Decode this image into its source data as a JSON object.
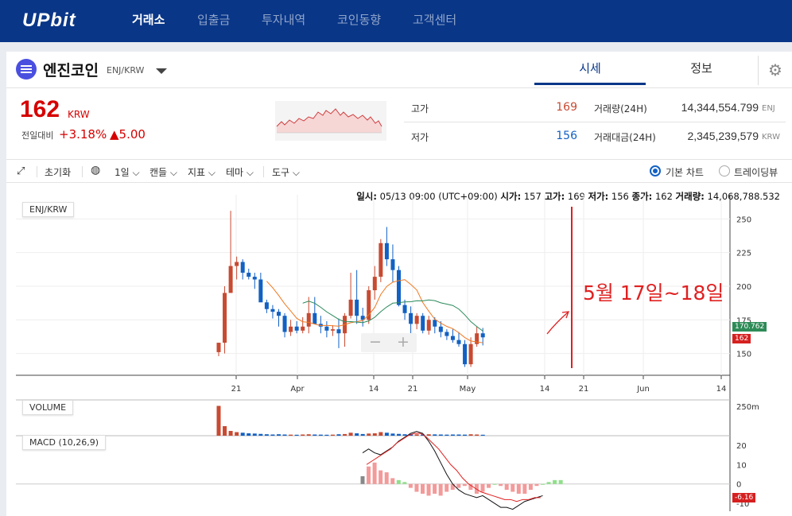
{
  "nav": {
    "logo": "UPbit",
    "items": [
      "거래소",
      "입출금",
      "투자내역",
      "코인동향",
      "고객센터"
    ]
  },
  "coin": {
    "name": "엔진코인",
    "pair": "ENJ/KRW",
    "icon": "enj-coin-icon"
  },
  "tabs": {
    "quote": "시세",
    "info": "정보"
  },
  "price": {
    "value": "162",
    "unit": "KRW",
    "change_label": "전일대비",
    "change_pct": "+3.18%",
    "change_abs": "▲5.00"
  },
  "stats": {
    "high_label": "고가",
    "high": "169",
    "low_label": "저가",
    "low": "156",
    "volume_label": "거래량(24H)",
    "volume": "14,344,554.799",
    "volume_unit": "ENJ",
    "amount_label": "거래대금(24H)",
    "amount": "2,345,239,579",
    "amount_unit": "KRW"
  },
  "toolbar": {
    "reset": "초기화",
    "period": "1일",
    "candle": "캔들",
    "indicator": "지표",
    "theme": "테마",
    "tools": "도구",
    "basic_chart": "기본 차트",
    "trading_view": "트레이딩뷰"
  },
  "infobar": {
    "date_label": "일시:",
    "date": "05/13 09:00 (UTC+09:00)",
    "open_label": "시가:",
    "open": "157",
    "high_label": "고가:",
    "high": "169",
    "low_label": "저가:",
    "low": "156",
    "close_label": "종가:",
    "close": "162",
    "volume_label": "거래량:",
    "volume": "14,068,788.532"
  },
  "chart_labels": {
    "main": "ENJ/KRW",
    "volume": "VOLUME",
    "macd": "MACD (10,26,9)"
  },
  "annotation": "5월 17일~18일",
  "price_tags": {
    "ma": "170.762",
    "last": "162"
  },
  "macd_tag": "-6.16",
  "colors": {
    "up": "#c84a31",
    "down": "#1261c4",
    "nav": "#093687",
    "accent": "#e02020"
  },
  "chart_data": {
    "type": "candlestick",
    "x_ticks": [
      "21",
      "Apr",
      "14",
      "21",
      "May",
      "14",
      "21",
      "Jun",
      "14"
    ],
    "y_ticks": [
      250,
      225,
      200,
      175,
      150
    ],
    "volume_ticks": [
      "250m"
    ],
    "macd_ticks": [
      20,
      10,
      0,
      -10
    ],
    "candles": [
      {
        "o": 151,
        "h": 158,
        "l": 148,
        "c": 158
      },
      {
        "o": 158,
        "h": 200,
        "l": 150,
        "c": 195
      },
      {
        "o": 195,
        "h": 256,
        "l": 195,
        "c": 215
      },
      {
        "o": 215,
        "h": 222,
        "l": 205,
        "c": 218
      },
      {
        "o": 218,
        "h": 220,
        "l": 205,
        "c": 210
      },
      {
        "o": 210,
        "h": 213,
        "l": 205,
        "c": 207
      },
      {
        "o": 207,
        "h": 210,
        "l": 198,
        "c": 205
      },
      {
        "o": 205,
        "h": 210,
        "l": 190,
        "c": 188
      },
      {
        "o": 188,
        "h": 190,
        "l": 180,
        "c": 183
      },
      {
        "o": 183,
        "h": 186,
        "l": 176,
        "c": 181
      },
      {
        "o": 181,
        "h": 183,
        "l": 170,
        "c": 178
      },
      {
        "o": 178,
        "h": 180,
        "l": 162,
        "c": 166
      },
      {
        "o": 166,
        "h": 175,
        "l": 163,
        "c": 170
      },
      {
        "o": 170,
        "h": 174,
        "l": 165,
        "c": 167
      },
      {
        "o": 167,
        "h": 177,
        "l": 165,
        "c": 170
      },
      {
        "o": 170,
        "h": 192,
        "l": 165,
        "c": 180
      },
      {
        "o": 180,
        "h": 192,
        "l": 172,
        "c": 172
      },
      {
        "o": 172,
        "h": 178,
        "l": 165,
        "c": 170
      },
      {
        "o": 170,
        "h": 174,
        "l": 162,
        "c": 167
      },
      {
        "o": 167,
        "h": 171,
        "l": 163,
        "c": 168
      },
      {
        "o": 168,
        "h": 176,
        "l": 154,
        "c": 165
      },
      {
        "o": 165,
        "h": 180,
        "l": 155,
        "c": 178
      },
      {
        "o": 178,
        "h": 210,
        "l": 176,
        "c": 190
      },
      {
        "o": 190,
        "h": 212,
        "l": 172,
        "c": 178
      },
      {
        "o": 178,
        "h": 184,
        "l": 170,
        "c": 175
      },
      {
        "o": 175,
        "h": 200,
        "l": 172,
        "c": 197
      },
      {
        "o": 197,
        "h": 215,
        "l": 190,
        "c": 207
      },
      {
        "o": 207,
        "h": 235,
        "l": 203,
        "c": 232
      },
      {
        "o": 232,
        "h": 244,
        "l": 215,
        "c": 220
      },
      {
        "o": 220,
        "h": 231,
        "l": 203,
        "c": 212
      },
      {
        "o": 212,
        "h": 215,
        "l": 185,
        "c": 186
      },
      {
        "o": 186,
        "h": 190,
        "l": 175,
        "c": 180
      },
      {
        "o": 180,
        "h": 185,
        "l": 165,
        "c": 172
      },
      {
        "o": 172,
        "h": 180,
        "l": 168,
        "c": 178
      },
      {
        "o": 178,
        "h": 180,
        "l": 165,
        "c": 167
      },
      {
        "o": 167,
        "h": 178,
        "l": 164,
        "c": 175
      },
      {
        "o": 175,
        "h": 177,
        "l": 165,
        "c": 170
      },
      {
        "o": 170,
        "h": 174,
        "l": 162,
        "c": 166
      },
      {
        "o": 166,
        "h": 168,
        "l": 160,
        "c": 163
      },
      {
        "o": 163,
        "h": 168,
        "l": 158,
        "c": 160
      },
      {
        "o": 160,
        "h": 166,
        "l": 155,
        "c": 157
      },
      {
        "o": 157,
        "h": 160,
        "l": 140,
        "c": 142
      },
      {
        "o": 142,
        "h": 162,
        "l": 140,
        "c": 157
      },
      {
        "o": 157,
        "h": 170,
        "l": 155,
        "c": 165
      },
      {
        "o": 165,
        "h": 169,
        "l": 156,
        "c": 162
      }
    ],
    "volume_bars": [
      250,
      80,
      40,
      30,
      25,
      20,
      18,
      15,
      12,
      10,
      12,
      10,
      9,
      8,
      10,
      12,
      10,
      9,
      8,
      9,
      12,
      14,
      25,
      20,
      14,
      18,
      20,
      30,
      25,
      18,
      15,
      12,
      14,
      11,
      10,
      12,
      11,
      10,
      9,
      10,
      10,
      9,
      12,
      10,
      8
    ],
    "macd_hist": [
      4,
      9,
      11,
      7,
      6,
      3,
      2,
      1,
      -2,
      -4,
      -5,
      -6,
      -5,
      -6,
      -4,
      -3,
      -2,
      -1,
      -3,
      -5,
      -4,
      -2,
      0,
      -1,
      -3,
      -4,
      -5,
      -5,
      -3,
      -1,
      0,
      1,
      2,
      2
    ],
    "macd_line": [
      16,
      18,
      16,
      15,
      17,
      19,
      22,
      24,
      26,
      27,
      26,
      22,
      17,
      11,
      5,
      0,
      -3,
      -5,
      -6,
      -7,
      -6,
      -8,
      -10,
      -12,
      -12,
      -13,
      -11,
      -9,
      -8,
      -7,
      -6
    ],
    "signal_line": [
      10,
      12,
      14,
      16,
      18,
      21,
      23,
      25,
      26,
      26,
      24,
      21,
      18,
      14,
      10,
      7,
      3,
      0,
      -2,
      -4,
      -5,
      -6,
      -7,
      -8,
      -8,
      -9,
      -8,
      -8,
      -7,
      -7
    ]
  }
}
